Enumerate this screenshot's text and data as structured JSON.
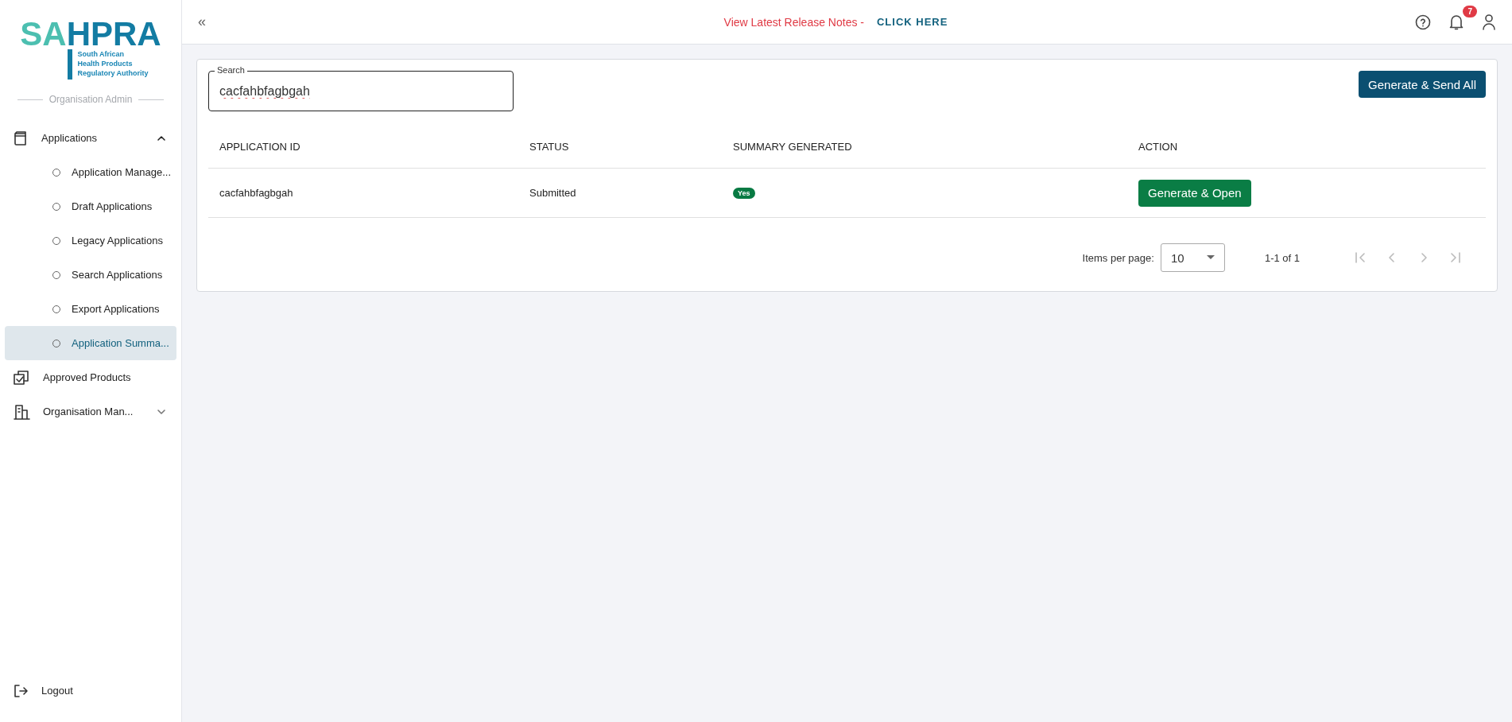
{
  "logo": {
    "part_1": "SA",
    "part_2": "HPRA",
    "tagline": [
      "South African",
      "Health Products",
      "Regulatory Authority"
    ]
  },
  "sidebar": {
    "section": "Organisation Admin",
    "items": [
      {
        "kind": "group",
        "label": "Applications",
        "expanded": true,
        "children": [
          {
            "label": "Application Manage...",
            "selected": false
          },
          {
            "label": "Draft Applications",
            "selected": false
          },
          {
            "label": "Legacy Applications",
            "selected": false
          },
          {
            "label": "Search Applications",
            "selected": false
          },
          {
            "label": "Export Applications",
            "selected": false
          },
          {
            "label": "Application Summa...",
            "selected": true
          }
        ]
      },
      {
        "kind": "link",
        "label": "Approved Products"
      },
      {
        "kind": "group",
        "label": "Organisation Man...",
        "expanded": false
      }
    ],
    "logout": "Logout"
  },
  "header": {
    "collapse": "«",
    "notes": "View Latest Release Notes -",
    "link": "CLICK HERE",
    "notification_count": "7"
  },
  "search": {
    "label": "Search",
    "value": "cacfahbfagbgah"
  },
  "send_all": "Generate & Send All",
  "table": {
    "columns": [
      "APPLICATION ID",
      "STATUS",
      "SUMMARY GENERATED",
      "ACTION"
    ],
    "rows": [
      {
        "id": "cacfahbfagbgah",
        "status": "Submitted",
        "summary": "Yes",
        "action": "Generate & Open"
      }
    ]
  },
  "pagination": {
    "label": "Items per page:",
    "page_size": "10",
    "range": "1-1 of 1",
    "first_disabled": true,
    "prev_disabled": true,
    "next_disabled": true,
    "last_disabled": true
  }
}
